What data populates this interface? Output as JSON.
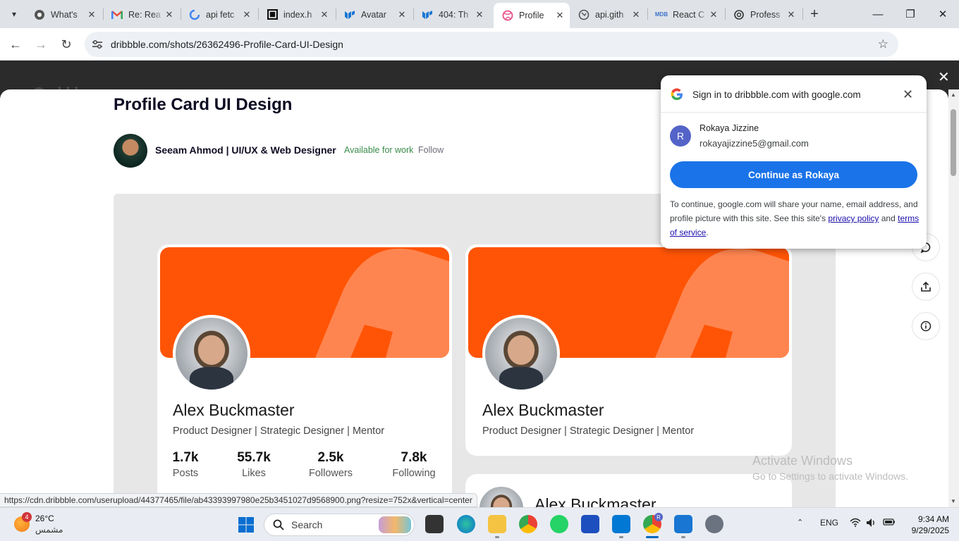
{
  "browser": {
    "tabs": [
      {
        "title": "What's",
        "icon": "chrome-logo-icon"
      },
      {
        "title": "Re: Rea",
        "icon": "gmail-icon"
      },
      {
        "title": "api fetc",
        "icon": "google-icon"
      },
      {
        "title": "index.h",
        "icon": "codesandbox-icon"
      },
      {
        "title": "Avatar ",
        "icon": "mui-icon"
      },
      {
        "title": "404: Th",
        "icon": "mui-icon"
      },
      {
        "title": "Profile ",
        "icon": "dribbble-icon",
        "active": true
      },
      {
        "title": "api.gith",
        "icon": "globe-icon"
      },
      {
        "title": "React C",
        "icon": "mdb-icon"
      },
      {
        "title": "Profess",
        "icon": "openai-icon"
      }
    ],
    "url": "dribbble.com/shots/26362496-Profile-Card-UI-Design",
    "profile_initial": "R"
  },
  "shot": {
    "title": "Profile Card UI Design",
    "author": "Seeam Ahmod | UI/UX & Web Designer",
    "availability": "Available for work",
    "follow": "Follow"
  },
  "cards": {
    "name": "Alex Buckmaster",
    "role": "Product Designer | Strategic Designer | Mentor",
    "stats": [
      {
        "value": "1.7k",
        "label": "Posts"
      },
      {
        "value": "55.7k",
        "label": "Likes"
      },
      {
        "value": "2.5k",
        "label": "Followers"
      },
      {
        "value": "7.8k",
        "label": "Following"
      }
    ],
    "banner_color": "#ff5405"
  },
  "google_popup": {
    "heading": "Sign in to dribbble.com with google.com",
    "account_initial": "R",
    "account_name": "Rokaya Jizzine",
    "account_email": "rokayajizzine5@gmail.com",
    "continue_label": "Continue as Rokaya",
    "note_before": "To continue, google.com will share your name, email address, and profile picture with this site. See this site's ",
    "privacy_link": "privacy policy",
    "note_and": " and ",
    "terms_link": "terms of service",
    "note_end": ".",
    "button_color": "#1a73e8"
  },
  "status_url": "https://cdn.dribbble.com/userupload/44377465/file/ab43393997980e25b3451027d9568900.png?resize=752x&vertical=center",
  "watermark": {
    "line1": "Activate Windows",
    "line2": "Go to Settings to activate Windows."
  },
  "taskbar": {
    "weather_badge": "4",
    "temperature": "26°C",
    "weather_desc": "مشمس",
    "search_label": "Search",
    "language": "ENG",
    "time": "9:34 AM",
    "date": "9/29/2025",
    "chrome_profile_badge": "R"
  }
}
